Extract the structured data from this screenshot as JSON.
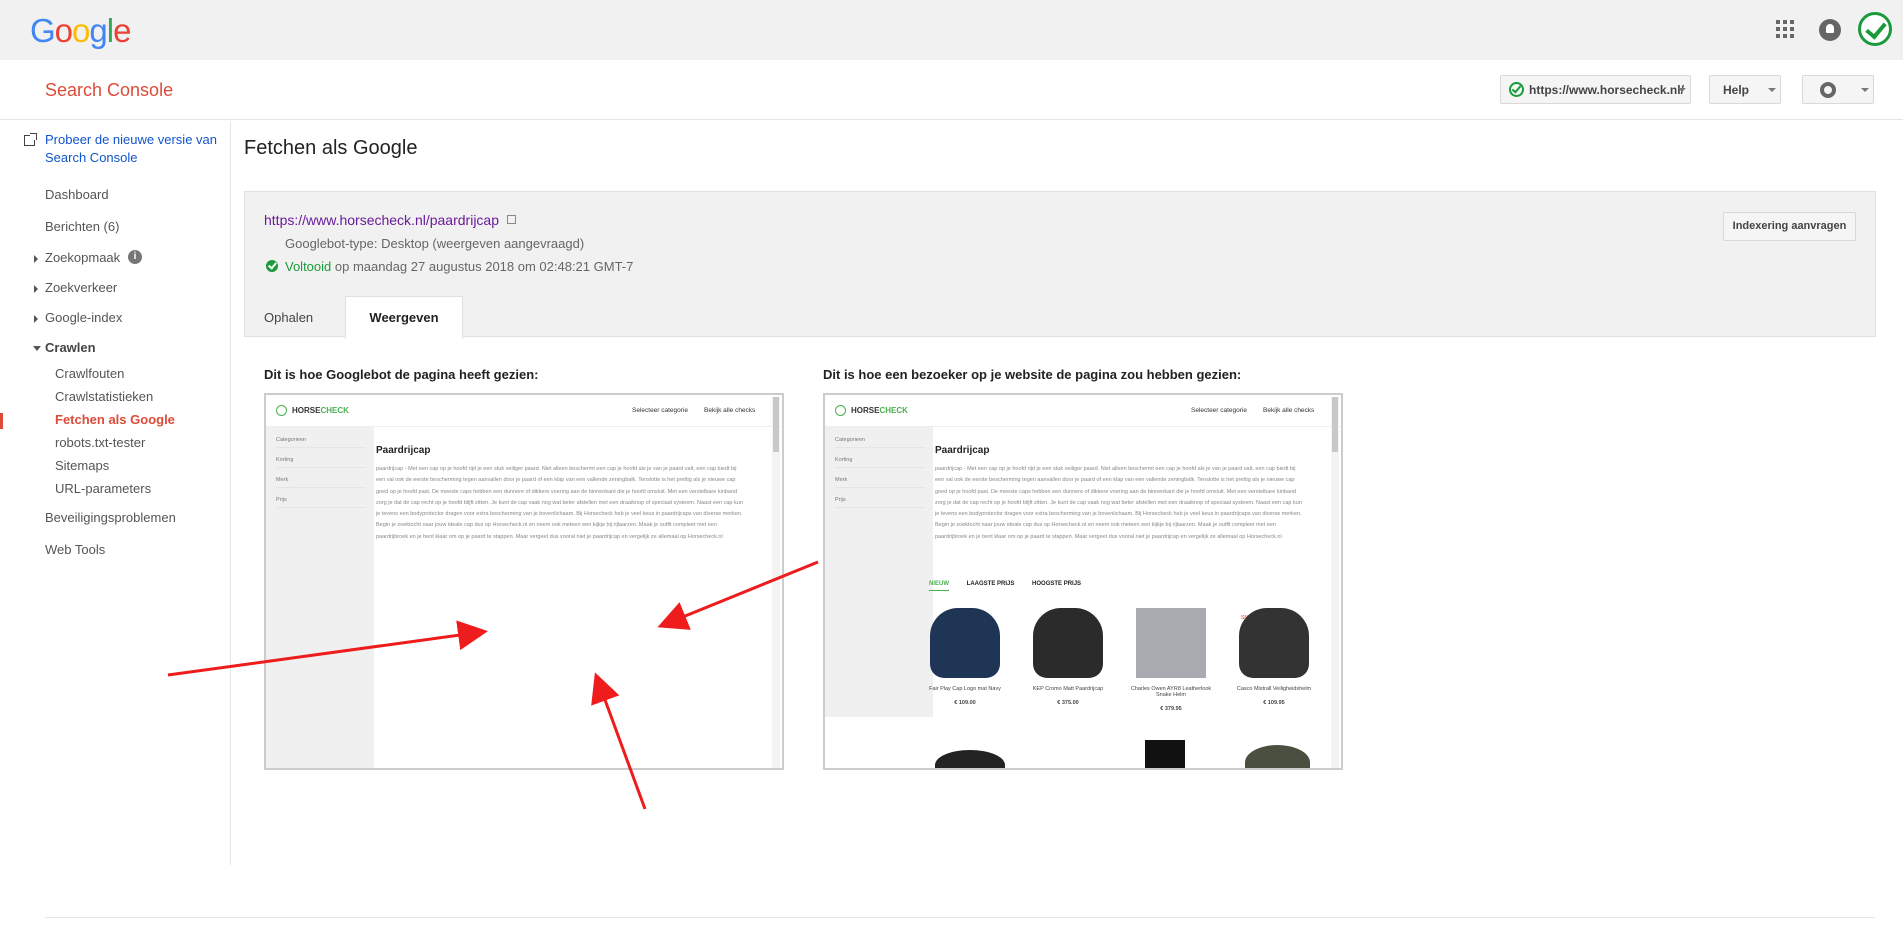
{
  "app": {
    "logo_text": "Google",
    "title": "Search Console"
  },
  "header": {
    "site_selector": "https://www.horsecheck.nl/",
    "help_label": "Help"
  },
  "sidebar": {
    "try_new": "Probeer de nieuwe versie van Search Console",
    "items": {
      "dashboard": "Dashboard",
      "berichten": "Berichten (6)",
      "zoekopmaak": "Zoekopmaak",
      "zoekverkeer": "Zoekverkeer",
      "google_index": "Google-index",
      "crawlen": "Crawlen",
      "crawlfouten": "Crawlfouten",
      "crawlstatistieken": "Crawlstatistieken",
      "fetchen": "Fetchen als Google",
      "robots": "robots.txt-tester",
      "sitemaps": "Sitemaps",
      "url_parameters": "URL-parameters",
      "beveiliging": "Beveiligingsproblemen",
      "web_tools": "Web Tools"
    }
  },
  "main": {
    "page_title": "Fetchen als Google",
    "fetched_url": "https://www.horsecheck.nl/paardrijcap",
    "bot_type": "Googlebot-type: Desktop (weergeven aangevraagd)",
    "status_word": "Voltooid",
    "status_rest": " op maandag 27 augustus 2018 om 02:48:21 GMT-7",
    "index_button": "Indexering aanvragen",
    "tabs": {
      "fetch": "Ophalen",
      "render": "Weergeven"
    },
    "caption_googlebot": "Dit is hoe Googlebot de pagina heeft gezien:",
    "caption_visitor": "Dit is hoe een bezoeker op je website de pagina zou hebben gezien:"
  },
  "preview": {
    "logo_a": "HORSE",
    "logo_b": "CHECK",
    "nav_category": "Selecteer categorie",
    "nav_checks": "Bekijk alle checks",
    "side": [
      "Categorieen",
      "Korting",
      "Merk",
      "Prijs"
    ],
    "heading": "Paardrijcap",
    "body": "paardrijcap - Met een cap op je hoofd rijd je een stuk veiliger paard. Niet alleen beschermt een cap je hoofd als je van je paard valt, een cap biedt bij een val ook de eerste bescherming tegen aanvallen door je paard of een klap van een vallende zeningbalk. Tenslotte is het prettig als je nieuwe cap goed op je hoofd past. De meeste caps hebben een dunnere of dikkere voering aan de binnenkant die je hoofd omsluit. Met een verstelbare kinband zorg je dat de cap recht op je hoofd blijft zitten. Je kunt de cap vaak nog wat beter afstellen met een draaiknop of speciaal systeem. Naast een cap kun je tevens een bodyprotector dragen voor extra bescherming van je bovenlichaam. Bij Horsecheck heb je veel keus in paardrijcaps van diverse merken. Begin je zoektocht naar jouw ideale cap dus op Horsecheck.nl en neem ook meteen een kijkje bij rijlaarzen. Maak je outfit compleet met een paardrijbroek en je bent klaar om op je paard te stappen. Maar vergeet dus vooral niet je paardrijcap en vergelijk ze allemaal op Horsecheck.nl",
    "filters": [
      "NIEUW",
      "LAAGSTE PRIJS",
      "HOOGSTE PRIJS"
    ],
    "sale_label": "SNOWALL",
    "products": [
      {
        "name": "Fair Play Cap Logo mat Navy",
        "price": "€ 109.00",
        "color": "#1f3556"
      },
      {
        "name": "KEP Cromo Matt Paardrijcap",
        "price": "€ 375.00",
        "color": "#2b2b2b"
      },
      {
        "name": "Charles Owen AYR8 Leatherlook Snake Helm",
        "price": "€ 379.95",
        "color": "#3a4a66"
      },
      {
        "name": "Casco Mistrall Veiligheidshelm",
        "price": "€ 109.95",
        "color": "#333333"
      }
    ]
  },
  "colors": {
    "brand_red": "#dd4b39",
    "link_blue": "#1155cc",
    "visited_purple": "#6a1b9a",
    "success_green": "#1a9a3a",
    "annotation_arrow": "#ee1c1c"
  }
}
